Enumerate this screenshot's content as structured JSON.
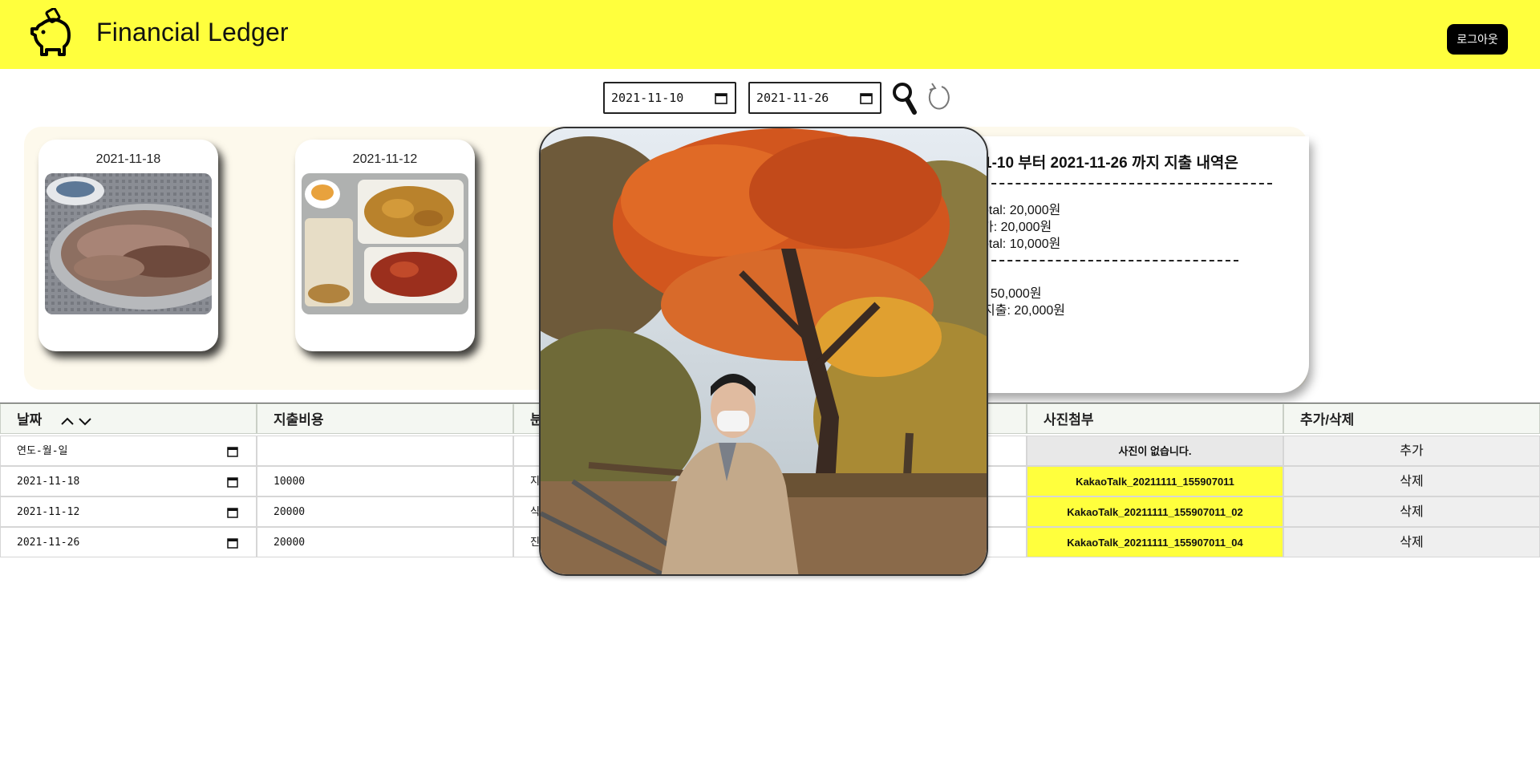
{
  "header": {
    "title": "Financial Ledger",
    "logout_label": "로그아웃"
  },
  "search": {
    "start_date": "2021-11-10",
    "end_date": "2021-11-26"
  },
  "cards": [
    {
      "date": "2021-11-18"
    },
    {
      "date": "2021-11-12"
    }
  ],
  "summary": {
    "title": "1-10 부터 2021-11-26 까지 지출 내역은",
    "lines_a": [
      "otal: 20,000원",
      "가: 20,000원",
      "otal: 10,000원"
    ],
    "lines_b": [
      ": 50,000원",
      "지출: 20,000원"
    ]
  },
  "table": {
    "headers": [
      "날짜",
      "지출비용",
      "분",
      "사진첨부",
      "추가/삭제"
    ],
    "new_row": {
      "date_placeholder": "연도-월-일",
      "photo": "사진이 없습니다.",
      "action": "추가"
    },
    "rows": [
      {
        "date": "2021-11-18",
        "cost": "10000",
        "cat": "지",
        "photo": "KakaoTalk_20211111_155907011",
        "action": "삭제"
      },
      {
        "date": "2021-11-12",
        "cost": "20000",
        "cat": "식",
        "photo": "KakaoTalk_20211111_155907011_02",
        "action": "삭제"
      },
      {
        "date": "2021-11-26",
        "cost": "20000",
        "cat": "진",
        "photo": "KakaoTalk_20211111_155907011_04",
        "action": "삭제"
      }
    ]
  },
  "colors": {
    "brand_yellow": "#ffff3d",
    "card_bg": "#fdf9ec",
    "header_cell": "#f4f7f2"
  }
}
